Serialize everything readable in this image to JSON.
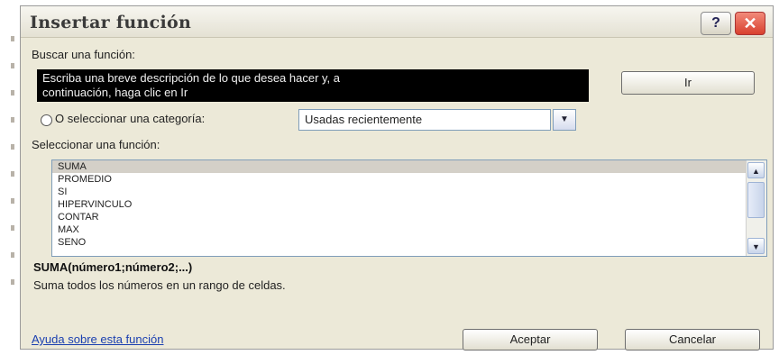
{
  "dialog": {
    "title": "Insertar función",
    "help_icon": "?",
    "close_icon": "✕"
  },
  "search": {
    "label": "Buscar una función:",
    "text_line1": "Escriba una breve descripción de lo que desea hacer y, a",
    "text_line2": "continuación, haga clic en Ir",
    "go_button": "Ir"
  },
  "category": {
    "label": "O seleccionar una categoría:",
    "selected": "Usadas recientemente"
  },
  "functions": {
    "label": "Seleccionar una función:",
    "items": [
      "SUMA",
      "PROMEDIO",
      "SI",
      "HIPERVINCULO",
      "CONTAR",
      "MAX",
      "SENO"
    ],
    "selected_index": 0
  },
  "details": {
    "syntax": "SUMA(número1;número2;...)",
    "description": "Suma todos los números en un rango de celdas."
  },
  "footer": {
    "help_link": "Ayuda sobre esta función",
    "ok_button": "Aceptar",
    "cancel_button": "Cancelar"
  }
}
